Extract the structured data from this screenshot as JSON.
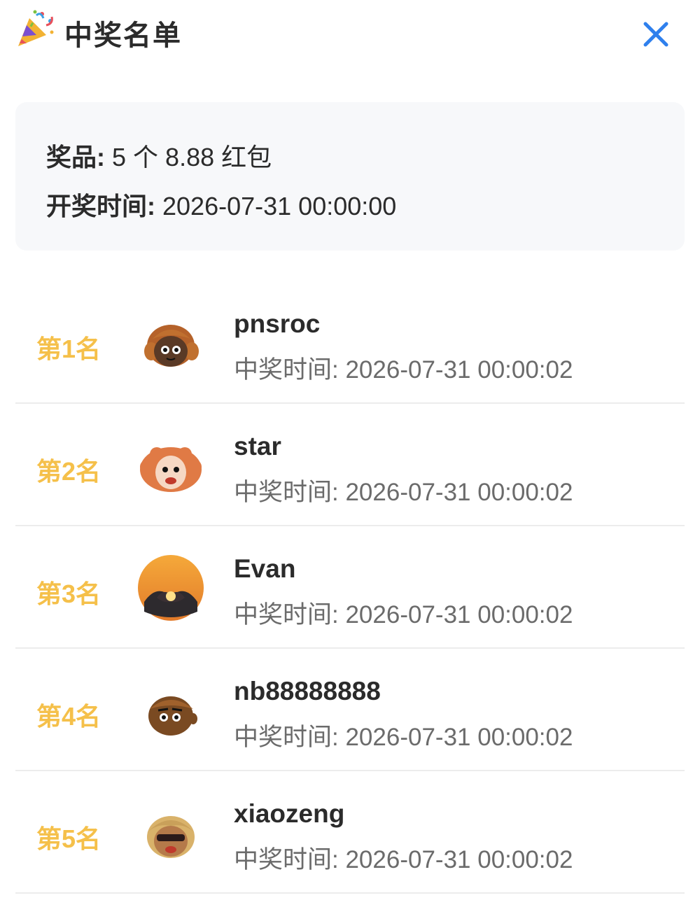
{
  "header": {
    "title": "中奖名单",
    "party_icon": "party-popper-icon",
    "close_icon": "close-icon",
    "close_color": "#2f80ed"
  },
  "info": {
    "prize_label": "奖品:",
    "prize_value": "5 个 8.88 红包",
    "draw_time_label": "开奖时间:",
    "draw_time_value": "2026-07-31 00:00:00"
  },
  "winners": [
    {
      "rank": "第1名",
      "name": "pnsroc",
      "time_label": "中奖时间:",
      "time": "2026-07-31 00:00:02"
    },
    {
      "rank": "第2名",
      "name": "star",
      "time_label": "中奖时间:",
      "time": "2026-07-31 00:00:02"
    },
    {
      "rank": "第3名",
      "name": "Evan",
      "time_label": "中奖时间:",
      "time": "2026-07-31 00:00:02"
    },
    {
      "rank": "第4名",
      "name": "nb88888888",
      "time_label": "中奖时间:",
      "time": "2026-07-31 00:00:02"
    },
    {
      "rank": "第5名",
      "name": "xiaozeng",
      "time_label": "中奖时间:",
      "time": "2026-07-31 00:00:02"
    }
  ],
  "colors": {
    "rank": "#f5c04a",
    "card_bg": "#f7f8fa",
    "divider": "#ececec"
  }
}
